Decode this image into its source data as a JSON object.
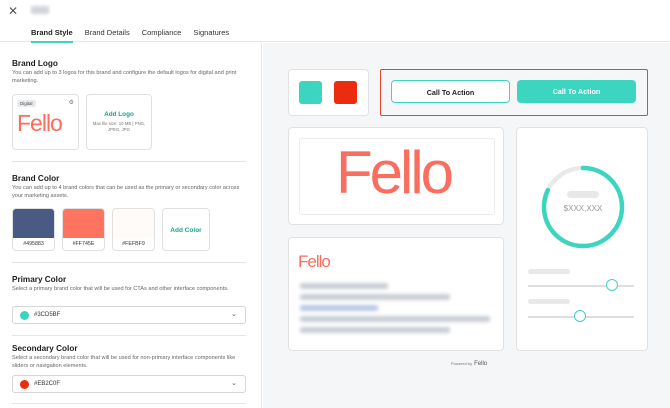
{
  "header": {
    "tabs": [
      {
        "label": "Brand Style",
        "active": true
      },
      {
        "label": "Brand Details",
        "active": false
      },
      {
        "label": "Compliance",
        "active": false
      },
      {
        "label": "Signatures",
        "active": false
      }
    ]
  },
  "brand_logo": {
    "title": "Brand Logo",
    "description": "You can add up to 3 logos for this brand and configure the default logos for digital and print marketing.",
    "card_badge": "Digital",
    "logo_text": "Fello",
    "add_logo_label": "Add Logo",
    "add_logo_meta": "Max file size: 10 MB | PNG, JPEG, JPG"
  },
  "brand_color": {
    "title": "Brand Color",
    "description": "You can add up to 4 brand colors that can be used as the primary or secondary color across your marketing assets.",
    "swatches": [
      {
        "hex": "#495B83",
        "label": "#495883"
      },
      {
        "hex": "#FF745E",
        "label": "#FF745E"
      },
      {
        "hex": "#FEFBF9",
        "label": "#FEFBF9"
      }
    ],
    "add_color_label": "Add Color"
  },
  "primary_color": {
    "title": "Primary Color",
    "description": "Select a primary brand color that will be used for CTAs and other interface components.",
    "value": "#3CD5BF",
    "color": "#3CD5BF"
  },
  "secondary_color": {
    "title": "Secondary Color",
    "description": "Select a secondary brand color that will be used for non-primary interface components like sliders or navigation elements.",
    "value": "#EB2C0F",
    "color": "#EB2C0F"
  },
  "preview": {
    "cta_outline_label": "Call To Action",
    "cta_filled_label": "Call To Action",
    "price_placeholder": "$XXX,XXX",
    "preview_logo_text": "Fello",
    "powered_by_label": "Powered by",
    "powered_by_brand": "Fello",
    "gauge_fraction": 0.82,
    "slider1_fraction": 0.79,
    "slider2_fraction": 0.49
  },
  "colors": {
    "accent": "#3CD5BF",
    "secondary": "#EB2C0F",
    "logo": "#F96E5E"
  }
}
